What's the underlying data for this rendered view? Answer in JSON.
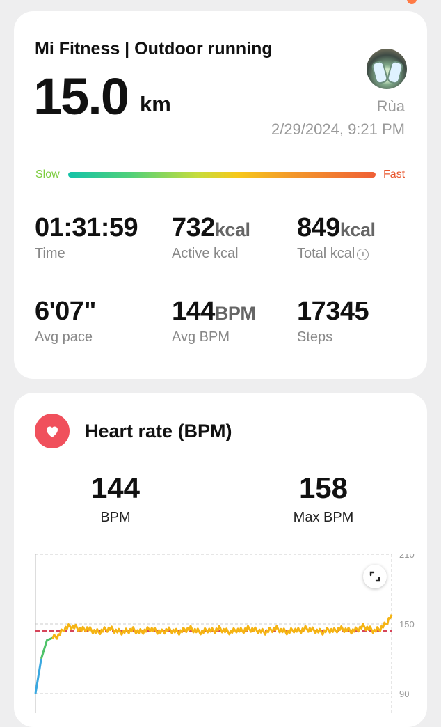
{
  "workout": {
    "title": "Mi Fitness | Outdoor running",
    "distance": "15.0",
    "distance_unit": "km",
    "user_name": "Rùa",
    "datetime": "2/29/2024, 9:21 PM",
    "pace_scale": {
      "slow_label": "Slow",
      "fast_label": "Fast"
    }
  },
  "stats": [
    {
      "value": "01:31:59",
      "unit": "",
      "label": "Time"
    },
    {
      "value": "732",
      "unit": "kcal",
      "label": "Active kcal"
    },
    {
      "value": "849",
      "unit": "kcal",
      "label": "Total kcal"
    },
    {
      "value": "6'07\"",
      "unit": "",
      "label": "Avg pace"
    },
    {
      "value": "144",
      "unit": "BPM",
      "label": "Avg BPM"
    },
    {
      "value": "17345",
      "unit": "",
      "label": "Steps"
    }
  ],
  "heart_rate": {
    "title": "Heart rate (BPM)",
    "avg_value": "144",
    "avg_label": "BPM",
    "max_value": "158",
    "max_label": "Max BPM"
  },
  "chart_data": {
    "type": "line",
    "ylim": [
      90,
      210
    ],
    "yticks": [
      "210",
      "150",
      "90"
    ],
    "reference_line": 144,
    "grid": true,
    "series": [
      {
        "values": [
          90,
          120,
          136,
          138,
          140,
          146,
          148,
          147,
          145,
          146,
          144,
          143,
          145,
          146,
          144,
          143,
          144,
          145,
          143,
          144,
          146,
          144,
          143,
          145,
          144,
          143,
          145,
          146,
          144,
          143,
          145,
          144,
          146,
          144,
          143,
          145,
          144,
          146,
          145,
          144,
          143,
          145,
          146,
          144,
          143,
          145,
          144,
          146,
          145,
          144,
          143,
          145,
          144,
          146,
          145,
          144,
          145,
          148,
          146,
          144,
          146,
          150,
          158
        ]
      }
    ],
    "colors": {
      "line_low": "#3aa8e0",
      "line_mid": "#4fc36a",
      "line_high": "#f5b414",
      "reference": "#d6455a"
    }
  }
}
